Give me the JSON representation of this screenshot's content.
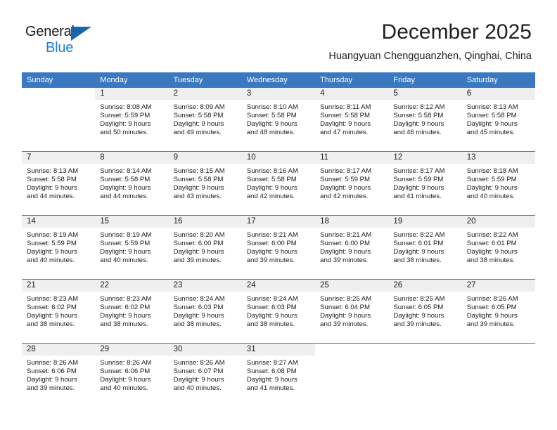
{
  "brand": {
    "name_part1": "General",
    "name_part2": "Blue",
    "triangle_color": "#1565b0",
    "blue_color": "#1a7fd4"
  },
  "header": {
    "title": "December 2025",
    "subtitle": "Huangyuan Chengguanzhen, Qinghai, China",
    "header_bg_color": "#3a78bf",
    "header_text_color": "#ffffff"
  },
  "weekdays": [
    "Sunday",
    "Monday",
    "Tuesday",
    "Wednesday",
    "Thursday",
    "Friday",
    "Saturday"
  ],
  "weeks": [
    [
      {
        "day": "",
        "blank": true,
        "lines": []
      },
      {
        "day": "1",
        "lines": [
          "Sunrise: 8:08 AM",
          "Sunset: 5:59 PM",
          "Daylight: 9 hours",
          "and 50 minutes."
        ]
      },
      {
        "day": "2",
        "lines": [
          "Sunrise: 8:09 AM",
          "Sunset: 5:58 PM",
          "Daylight: 9 hours",
          "and 49 minutes."
        ]
      },
      {
        "day": "3",
        "lines": [
          "Sunrise: 8:10 AM",
          "Sunset: 5:58 PM",
          "Daylight: 9 hours",
          "and 48 minutes."
        ]
      },
      {
        "day": "4",
        "lines": [
          "Sunrise: 8:11 AM",
          "Sunset: 5:58 PM",
          "Daylight: 9 hours",
          "and 47 minutes."
        ]
      },
      {
        "day": "5",
        "lines": [
          "Sunrise: 8:12 AM",
          "Sunset: 5:58 PM",
          "Daylight: 9 hours",
          "and 46 minutes."
        ]
      },
      {
        "day": "6",
        "lines": [
          "Sunrise: 8:13 AM",
          "Sunset: 5:58 PM",
          "Daylight: 9 hours",
          "and 45 minutes."
        ]
      }
    ],
    [
      {
        "day": "7",
        "lines": [
          "Sunrise: 8:13 AM",
          "Sunset: 5:58 PM",
          "Daylight: 9 hours",
          "and 44 minutes."
        ]
      },
      {
        "day": "8",
        "lines": [
          "Sunrise: 8:14 AM",
          "Sunset: 5:58 PM",
          "Daylight: 9 hours",
          "and 44 minutes."
        ]
      },
      {
        "day": "9",
        "lines": [
          "Sunrise: 8:15 AM",
          "Sunset: 5:58 PM",
          "Daylight: 9 hours",
          "and 43 minutes."
        ]
      },
      {
        "day": "10",
        "lines": [
          "Sunrise: 8:16 AM",
          "Sunset: 5:58 PM",
          "Daylight: 9 hours",
          "and 42 minutes."
        ]
      },
      {
        "day": "11",
        "lines": [
          "Sunrise: 8:17 AM",
          "Sunset: 5:59 PM",
          "Daylight: 9 hours",
          "and 42 minutes."
        ]
      },
      {
        "day": "12",
        "lines": [
          "Sunrise: 8:17 AM",
          "Sunset: 5:59 PM",
          "Daylight: 9 hours",
          "and 41 minutes."
        ]
      },
      {
        "day": "13",
        "lines": [
          "Sunrise: 8:18 AM",
          "Sunset: 5:59 PM",
          "Daylight: 9 hours",
          "and 40 minutes."
        ]
      }
    ],
    [
      {
        "day": "14",
        "lines": [
          "Sunrise: 8:19 AM",
          "Sunset: 5:59 PM",
          "Daylight: 9 hours",
          "and 40 minutes."
        ]
      },
      {
        "day": "15",
        "lines": [
          "Sunrise: 8:19 AM",
          "Sunset: 5:59 PM",
          "Daylight: 9 hours",
          "and 40 minutes."
        ]
      },
      {
        "day": "16",
        "lines": [
          "Sunrise: 8:20 AM",
          "Sunset: 6:00 PM",
          "Daylight: 9 hours",
          "and 39 minutes."
        ]
      },
      {
        "day": "17",
        "lines": [
          "Sunrise: 8:21 AM",
          "Sunset: 6:00 PM",
          "Daylight: 9 hours",
          "and 39 minutes."
        ]
      },
      {
        "day": "18",
        "lines": [
          "Sunrise: 8:21 AM",
          "Sunset: 6:00 PM",
          "Daylight: 9 hours",
          "and 39 minutes."
        ]
      },
      {
        "day": "19",
        "lines": [
          "Sunrise: 8:22 AM",
          "Sunset: 6:01 PM",
          "Daylight: 9 hours",
          "and 38 minutes."
        ]
      },
      {
        "day": "20",
        "lines": [
          "Sunrise: 8:22 AM",
          "Sunset: 6:01 PM",
          "Daylight: 9 hours",
          "and 38 minutes."
        ]
      }
    ],
    [
      {
        "day": "21",
        "lines": [
          "Sunrise: 8:23 AM",
          "Sunset: 6:02 PM",
          "Daylight: 9 hours",
          "and 38 minutes."
        ]
      },
      {
        "day": "22",
        "lines": [
          "Sunrise: 8:23 AM",
          "Sunset: 6:02 PM",
          "Daylight: 9 hours",
          "and 38 minutes."
        ]
      },
      {
        "day": "23",
        "lines": [
          "Sunrise: 8:24 AM",
          "Sunset: 6:03 PM",
          "Daylight: 9 hours",
          "and 38 minutes."
        ]
      },
      {
        "day": "24",
        "lines": [
          "Sunrise: 8:24 AM",
          "Sunset: 6:03 PM",
          "Daylight: 9 hours",
          "and 38 minutes."
        ]
      },
      {
        "day": "25",
        "lines": [
          "Sunrise: 8:25 AM",
          "Sunset: 6:04 PM",
          "Daylight: 9 hours",
          "and 39 minutes."
        ]
      },
      {
        "day": "26",
        "lines": [
          "Sunrise: 8:25 AM",
          "Sunset: 6:05 PM",
          "Daylight: 9 hours",
          "and 39 minutes."
        ]
      },
      {
        "day": "27",
        "lines": [
          "Sunrise: 8:26 AM",
          "Sunset: 6:05 PM",
          "Daylight: 9 hours",
          "and 39 minutes."
        ]
      }
    ],
    [
      {
        "day": "28",
        "lines": [
          "Sunrise: 8:26 AM",
          "Sunset: 6:06 PM",
          "Daylight: 9 hours",
          "and 39 minutes."
        ]
      },
      {
        "day": "29",
        "lines": [
          "Sunrise: 8:26 AM",
          "Sunset: 6:06 PM",
          "Daylight: 9 hours",
          "and 40 minutes."
        ]
      },
      {
        "day": "30",
        "lines": [
          "Sunrise: 8:26 AM",
          "Sunset: 6:07 PM",
          "Daylight: 9 hours",
          "and 40 minutes."
        ]
      },
      {
        "day": "31",
        "lines": [
          "Sunrise: 8:27 AM",
          "Sunset: 6:08 PM",
          "Daylight: 9 hours",
          "and 41 minutes."
        ]
      },
      {
        "day": "",
        "blank": true,
        "lines": []
      },
      {
        "day": "",
        "blank": true,
        "lines": []
      },
      {
        "day": "",
        "blank": true,
        "lines": []
      }
    ]
  ]
}
